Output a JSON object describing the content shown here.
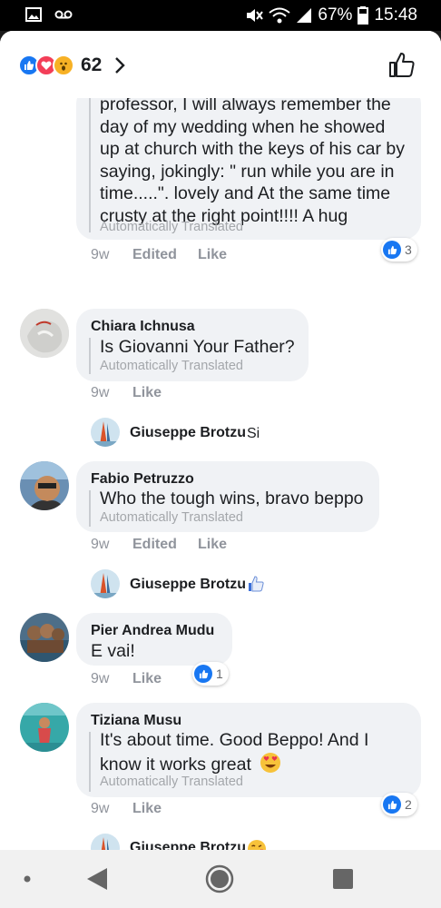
{
  "status": {
    "battery": "67%",
    "time": "15:48",
    "icons": [
      "gallery-icon",
      "voicemail-icon",
      "mute-icon",
      "wifi-icon",
      "signal-icon",
      "battery-icon"
    ]
  },
  "header": {
    "reaction_count": "62",
    "reactions": [
      "like",
      "love",
      "wow"
    ]
  },
  "comments": [
    {
      "lines": [
        "professor, I will always remember the",
        "day of my wedding when he showed",
        "up at church with the keys of his car by",
        "saying, jokingly: \" run while you are in",
        "time.....\". lovely and At the same time",
        "crusty at the right point!!!! A hug"
      ],
      "translated": "Automatically Translated",
      "time": "9w",
      "edited": "Edited",
      "like": "Like",
      "likes": "3"
    },
    {
      "name": "Chiara Ichnusa",
      "text": "Is Giovanni Your Father?",
      "translated": "Automatically Translated",
      "time": "9w",
      "like": "Like",
      "reply": {
        "name": "Giuseppe Brotzu",
        "text": "Si"
      }
    },
    {
      "name": "Fabio Petruzzo",
      "text": "Who the tough wins, bravo beppo",
      "translated": "Automatically Translated",
      "time": "9w",
      "edited": "Edited",
      "like": "Like",
      "reply": {
        "name": "Giuseppe Brotzu",
        "emoji": "thumbs-up"
      }
    },
    {
      "name": "Pier Andrea Mudu",
      "text": "E vai!",
      "time": "9w",
      "like": "Like",
      "likes": "1"
    },
    {
      "name": "Tiziana Musu",
      "lines": [
        "It's about time. Good Beppo! And I",
        "know it works great"
      ],
      "translated": "Automatically Translated",
      "time": "9w",
      "like": "Like",
      "likes": "2",
      "reply": {
        "name": "Giuseppe Brotzu",
        "emoji": "kiss-face"
      }
    }
  ],
  "colors": {
    "accent": "#1877f2",
    "bubble": "#f0f2f5",
    "meta_text": "#90949c"
  }
}
